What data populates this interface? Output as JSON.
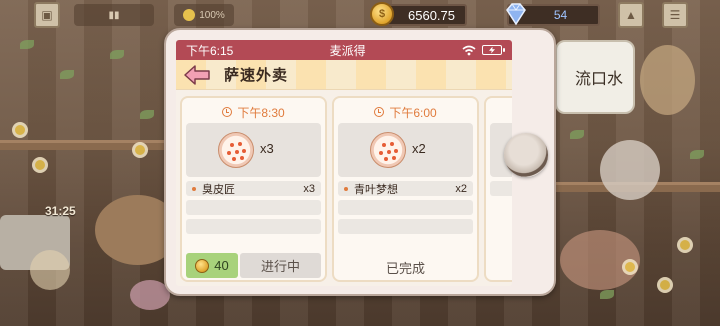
{
  "hud": {
    "coins": "6560.75",
    "gems": "54",
    "status_percent": "100%",
    "side_note": "流口水",
    "timer": "31:25"
  },
  "phone": {
    "status_bar": {
      "time": "下午6:15",
      "app_name": "麦派得"
    },
    "header": {
      "title": "萨速外卖"
    },
    "orders": [
      {
        "time": "下午8:30",
        "food_count": "x3",
        "items": [
          {
            "name": "臭皮匠",
            "qty": "x3"
          }
        ],
        "reward": "40",
        "status": "进行中"
      },
      {
        "time": "下午6:00",
        "food_count": "x2",
        "items": [
          {
            "name": "青叶梦想",
            "qty": "x2"
          }
        ],
        "status": "已完成"
      }
    ]
  },
  "colors": {
    "status_bar": "#b34a55",
    "time_accent": "#e07b3d",
    "reward_bg": "#a8d27b"
  }
}
